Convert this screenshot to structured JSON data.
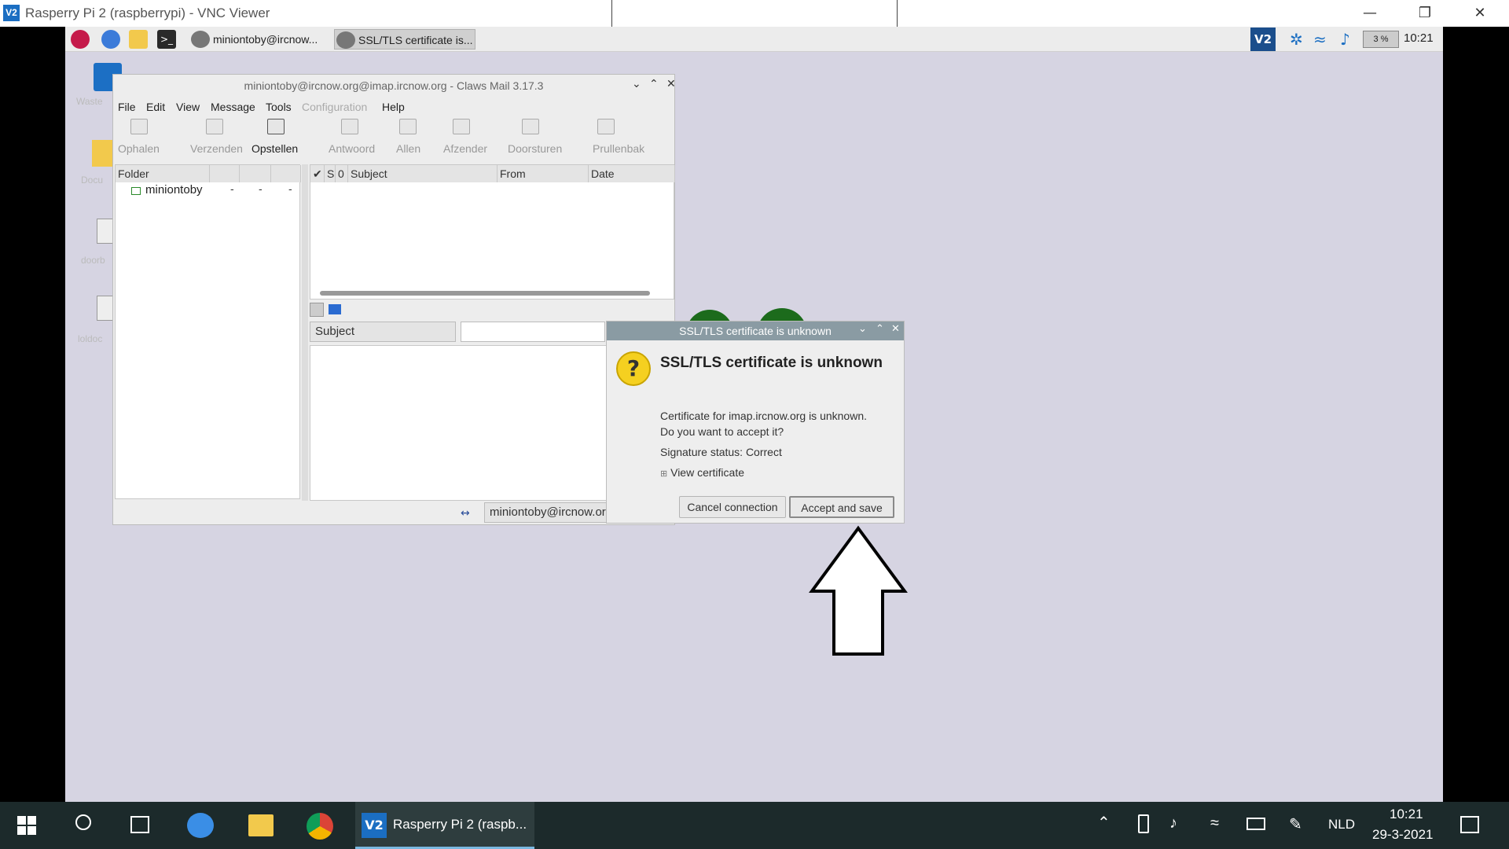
{
  "vnc": {
    "title": "Rasperry Pi 2 (raspberrypi) - VNC Viewer",
    "logo_text": "V2",
    "minimize_icon": "minimize-icon",
    "restore_icon": "restore-icon",
    "close_icon": "close-icon"
  },
  "pi_panel": {
    "taskbuttons": [
      {
        "label": "miniontoby@ircnow...",
        "icon": "claws-mail-icon"
      },
      {
        "label": "SSL/TLS certificate is...",
        "icon": "claws-mail-icon"
      }
    ],
    "tray": {
      "vnc_label": "V2",
      "cpu": "3 %",
      "clock": "10:21"
    }
  },
  "desktop": {
    "icons": [
      {
        "label": "Waste"
      },
      {
        "label": "Docu"
      },
      {
        "label": "doorb"
      },
      {
        "label": "loldoc"
      }
    ]
  },
  "claws": {
    "title": "miniontoby@ircnow.org@imap.ircnow.org - Claws Mail 3.17.3",
    "menu": [
      "File",
      "Edit",
      "View",
      "Message",
      "Tools",
      "Configuration",
      "Help"
    ],
    "toolbar": [
      "Ophalen",
      "Verzenden",
      "Opstellen",
      "Antwoord",
      "Allen",
      "Afzender",
      "Doorsturen",
      "Prullenbak"
    ],
    "folder_header": "Folder",
    "folder_row": {
      "name": "miniontoby",
      "c1": "-",
      "c2": "-",
      "c3": "-"
    },
    "list_headers": {
      "check": "✔",
      "s": "S",
      "att": "0",
      "subject": "Subject",
      "from": "From",
      "date": "Date"
    },
    "search_field": "Subject",
    "status_account": "miniontoby@ircnow.org@ir"
  },
  "dialog": {
    "title": "SSL/TLS certificate is unknown",
    "heading": "SSL/TLS certificate is unknown",
    "line1": "Certificate for imap.ircnow.org is unknown.",
    "line2": "Do you want to accept it?",
    "signature": "Signature status: Correct",
    "expander": "View certificate",
    "expander_icon": "⊞",
    "cancel": "Cancel connection",
    "accept": "Accept and save"
  },
  "win_taskbar": {
    "app_label": "Rasperry Pi 2 (raspb...",
    "lang": "NLD",
    "time": "10:21",
    "date": "29-3-2021"
  },
  "colors": {
    "desktop_bg": "#d6d4e2",
    "win_taskbar": "#1c2a2b",
    "dialog_title_bar": "#8a9ba3"
  }
}
